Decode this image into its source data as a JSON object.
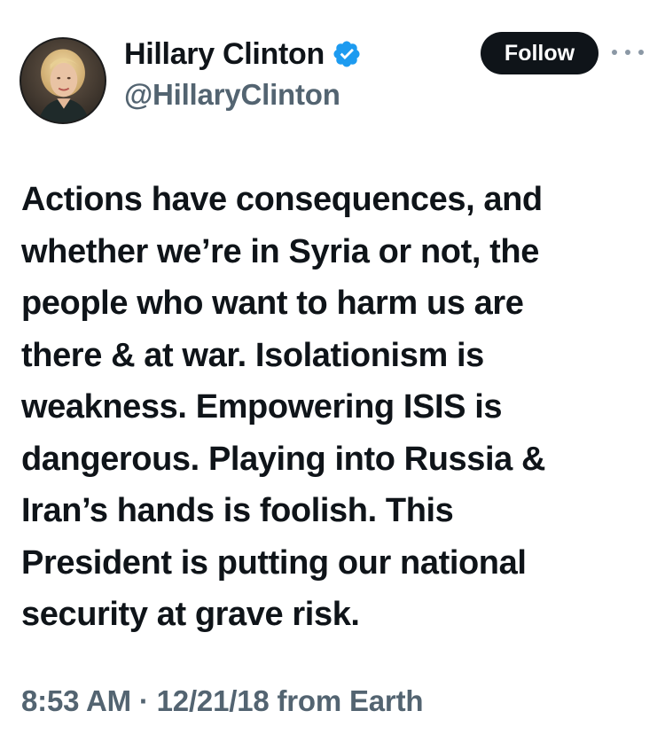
{
  "author": {
    "display_name": "Hillary Clinton",
    "handle": "@HillaryClinton",
    "avatar_icon": "avatar-photo",
    "verified_icon": "verified-badge-icon",
    "verified_color": "#1d9bf0"
  },
  "actions": {
    "follow_label": "Follow",
    "more_icon": "more-options-icon"
  },
  "tweet": {
    "lines": [
      "Actions have consequences, and",
      "whether we’re in Syria or not, the",
      "people who want to harm us are",
      "there & at war. Isolationism is",
      "weakness. Empowering ISIS is",
      "dangerous. Playing into Russia &",
      "Iran’s hands is foolish. This",
      "President is putting our national",
      "security at grave risk."
    ],
    "timestamp": "8:53 AM · 12/21/18 from Earth"
  },
  "colors": {
    "text": "#0f1419",
    "secondary": "#536471",
    "button_bg": "#0f1419",
    "button_text": "#ffffff",
    "background": "#ffffff"
  }
}
